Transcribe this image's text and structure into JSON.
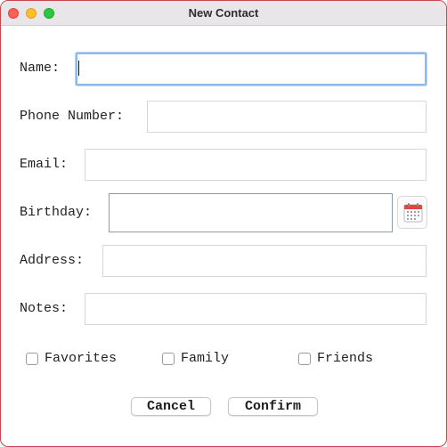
{
  "window": {
    "title": "New Contact"
  },
  "form": {
    "name_label": "Name:",
    "name_value": "",
    "phone_label": "Phone Number:",
    "phone_value": "",
    "email_label": "Email:",
    "email_value": "",
    "birthday_label": "Birthday:",
    "birthday_value": "",
    "address_label": "Address:",
    "address_value": "",
    "notes_label": "Notes:",
    "notes_value": ""
  },
  "checkboxes": [
    {
      "label": "Favorites",
      "checked": false
    },
    {
      "label": "Family",
      "checked": false
    },
    {
      "label": "Friends",
      "checked": false
    }
  ],
  "buttons": {
    "cancel": "Cancel",
    "confirm": "Confirm"
  },
  "icons": {
    "calendar": "calendar-icon"
  },
  "colors": {
    "focus_ring": "#8cb8ec",
    "close": "#fe5f57",
    "minimize": "#febc2e",
    "maximize": "#28c840",
    "calendar_red": "#e0483e"
  }
}
